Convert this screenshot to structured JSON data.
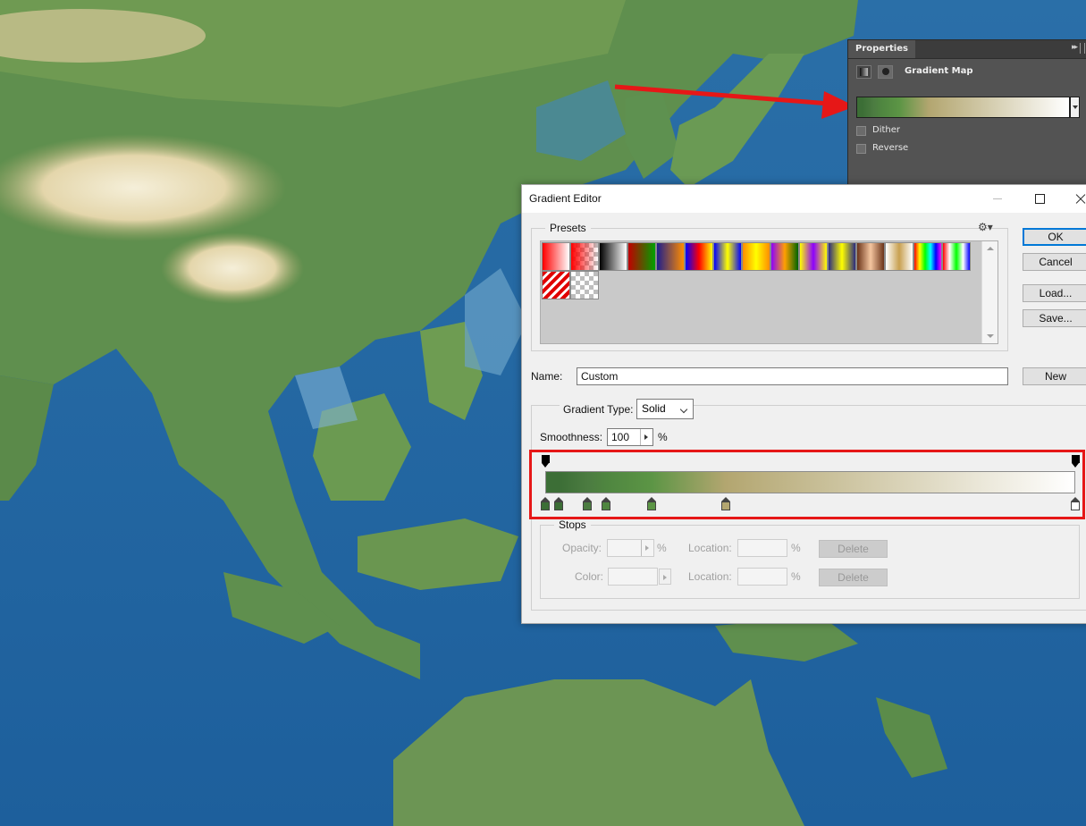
{
  "properties": {
    "tab": "Properties",
    "title": "Gradient Map",
    "dither_label": "Dither",
    "reverse_label": "Reverse"
  },
  "editor": {
    "title": "Gradient Editor",
    "presets_label": "Presets",
    "preset_colors": [
      [
        "#ff0000",
        "#ffffff"
      ],
      [
        "#ff0000",
        "transparent"
      ],
      [
        "#000000",
        "#ffffff"
      ],
      [
        "#c00000",
        "#00a000"
      ],
      [
        "#1e1e8c",
        "#ff8c00"
      ],
      [
        "#0000ff",
        "#ff0000",
        "#ffff00"
      ],
      [
        "#0000ff",
        "#ffff00",
        "#0000ff"
      ],
      [
        "#ff8c00",
        "#ffff00",
        "#ff8c00"
      ],
      [
        "#8c00ff",
        "#ffa000",
        "#006400"
      ],
      [
        "#ffff00",
        "#8c00ff",
        "#ffff00"
      ],
      [
        "#2a2a80",
        "#ffff00",
        "#2a2a80"
      ],
      [
        "#6b3419",
        "#f5c6a0",
        "#6b3419"
      ],
      [
        "#ffffff",
        "#c8a050",
        "#ffffff"
      ],
      [
        "#ff0000",
        "#ffff00",
        "#00ff00",
        "#00ffff",
        "#0000ff",
        "#ff00ff"
      ],
      [
        "#ff0000",
        "#ffffff",
        "#00ff00",
        "#ffffff",
        "#0000ff"
      ],
      [
        "#ff0000",
        "#ffffff"
      ],
      [
        "#cccccc",
        "#ffffff"
      ]
    ],
    "buttons": {
      "ok": "OK",
      "cancel": "Cancel",
      "load": "Load...",
      "save": "Save...",
      "new": "New"
    },
    "name_label": "Name:",
    "name_value": "Custom",
    "gradient_type_label": "Gradient Type:",
    "gradient_type_value": "Solid",
    "smoothness_label": "Smoothness:",
    "smoothness_value": "100",
    "percent": "%",
    "opacity_stops": [
      0,
      100
    ],
    "color_stops": [
      {
        "location": 0,
        "color": "#3c6e36"
      },
      {
        "location": 2.5,
        "color": "#3c6e36"
      },
      {
        "location": 8,
        "color": "#4c7c41"
      },
      {
        "location": 11.5,
        "color": "#4f8640"
      },
      {
        "location": 20,
        "color": "#5c9545"
      },
      {
        "location": 34,
        "color": "#b3a670"
      },
      {
        "location": 100,
        "color": "#ffffff"
      }
    ],
    "stops": {
      "label": "Stops",
      "opacity_label": "Opacity:",
      "color_label": "Color:",
      "location_label": "Location:",
      "delete_label": "Delete"
    }
  }
}
